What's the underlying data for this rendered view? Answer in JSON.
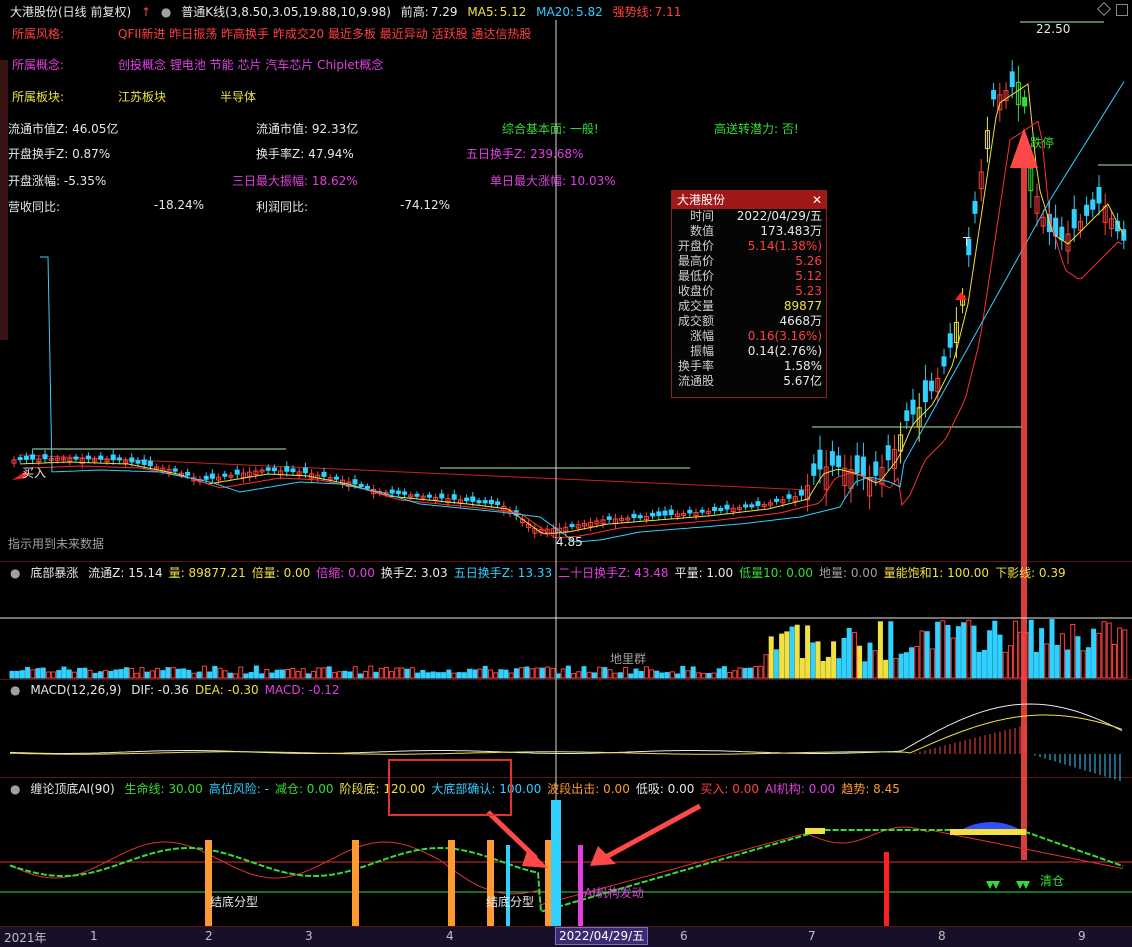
{
  "header": {
    "stock": "大港股份(日线 前复权)",
    "kline": "普通K线(3,8.50,3.05,19.88,10,9.98)",
    "prev_high_label": "前高:",
    "prev_high": "7.29",
    "ma5_label": "MA5:",
    "ma5": "5.12",
    "ma20_label": "MA20:",
    "ma20": "5.82",
    "strong_label": "强势线:",
    "strong": "7.11"
  },
  "info": {
    "style_label": "所属风格:",
    "style_value": "QFII新进 昨日振荡 昨高换手 昨成交20 最近多板 最近异动 活跃股 通达信热股",
    "concept_label": "所属概念:",
    "concept_value": "创投概念 锂电池 节能 芯片 汽车芯片 Chiplet概念",
    "sector_label": "所属板块:",
    "sector_a": "江苏板块",
    "sector_b": "半导体",
    "float_mv_z": "流通市值Z: 46.05亿",
    "float_mv": "流通市值: 92.33亿",
    "fundamental": "综合基本面: 一般!",
    "high_send": "高送转潜力: 否!",
    "open_turn_z": "开盘换手Z: 0.87%",
    "turn_z": "换手率Z: 47.94%",
    "five_turn_z": "五日换手Z: 239.68%",
    "open_rise": "开盘涨幅: -5.35%",
    "max3_amp": "三日最大振幅: 18.62%",
    "max_day_rise": "单日最大涨幅: 10.03%",
    "rev_yoy_label": "营收同比:",
    "rev_yoy": "-18.24%",
    "profit_yoy_label": "利润同比:",
    "profit_yoy": "-74.12%"
  },
  "price_panel": {
    "high_mark": "22.50",
    "low_mark": "4.85",
    "buy_label": "买入",
    "limit_label": "跌停",
    "t_label": "T",
    "future_note": "指示用到未来数据"
  },
  "tooltip": {
    "title": "大港股份",
    "rows": [
      {
        "k": "时间",
        "v": "2022/04/29/五",
        "color": "#e8e8e8"
      },
      {
        "k": "数值",
        "v": "173.483万",
        "color": "#e8e8e8"
      },
      {
        "k": "开盘价",
        "v": "5.14(1.38%)",
        "color": "#ff4040"
      },
      {
        "k": "最高价",
        "v": "5.26",
        "color": "#ff4040"
      },
      {
        "k": "最低价",
        "v": "5.12",
        "color": "#ff4040"
      },
      {
        "k": "收盘价",
        "v": "5.23",
        "color": "#ff4040"
      },
      {
        "k": "成交量",
        "v": "89877",
        "color": "#f0e040"
      },
      {
        "k": "成交额",
        "v": "4668万",
        "color": "#e8e8e8"
      },
      {
        "k": "涨幅",
        "v": "0.16(3.16%)",
        "color": "#ff4040"
      },
      {
        "k": "振幅",
        "v": "0.14(2.76%)",
        "color": "#e8e8e8"
      },
      {
        "k": "换手率",
        "v": "1.58%",
        "color": "#e8e8e8"
      },
      {
        "k": "流通股",
        "v": "5.67亿",
        "color": "#e8e8e8"
      }
    ]
  },
  "vol_panel": {
    "title": "底部暴涨",
    "items": [
      {
        "t": "流通Z: 15.14",
        "c": "#e8e8e8"
      },
      {
        "t": "量: 89877.21",
        "c": "#f0e040"
      },
      {
        "t": "倍量: 0.00",
        "c": "#f0e040"
      },
      {
        "t": "倍缩: 0.00",
        "c": "#e040e0"
      },
      {
        "t": "换手Z: 3.03",
        "c": "#e8e8e8"
      },
      {
        "t": "五日换手Z: 13.33",
        "c": "#30d0ff"
      },
      {
        "t": "二十日换手Z: 43.48",
        "c": "#e040e0"
      },
      {
        "t": "平量: 1.00",
        "c": "#e8e8e8"
      },
      {
        "t": "低量10: 0.00",
        "c": "#33dd33"
      },
      {
        "t": "地量: 0.00",
        "c": "#a0a0a0"
      },
      {
        "t": "量能饱和1: 100.00",
        "c": "#f0e040"
      },
      {
        "t": "下影线: 0.39",
        "c": "#f0e040"
      }
    ],
    "ground_label": "地里群"
  },
  "macd_panel": {
    "title": "MACD(12,26,9)",
    "items": [
      {
        "t": "DIF: -0.36",
        "c": "#e8e8e8"
      },
      {
        "t": "DEA: -0.30",
        "c": "#f0e040"
      },
      {
        "t": "MACD: -0.12",
        "c": "#e040e0"
      }
    ]
  },
  "ai_panel": {
    "title": "缠论顶底AI(90)",
    "items": [
      {
        "t": "生命线: 30.00",
        "c": "#33dd33"
      },
      {
        "t": "高位风险: -",
        "c": "#30d0ff"
      },
      {
        "t": "减仓: 0.00",
        "c": "#33dd33"
      },
      {
        "t": "阶段底: 120.00",
        "c": "#f0e040"
      },
      {
        "t": "大底部确认: 100.00",
        "c": "#30d0ff"
      },
      {
        "t": "波段出击: 0.00",
        "c": "#ff9a30"
      },
      {
        "t": "低吸: 0.00",
        "c": "#e8e8e8"
      },
      {
        "t": "买入: 0.00",
        "c": "#ff4040"
      },
      {
        "t": "AI机构: 0.00",
        "c": "#e040e0"
      },
      {
        "t": "趋势: 8.45",
        "c": "#ff9a30"
      }
    ],
    "bottom_pattern_a": "结底分型",
    "bottom_pattern_b": "结底分型",
    "inst_label": "AI机构发动",
    "clear_label": "清仓"
  },
  "axis": {
    "labels": [
      "2021年",
      "1",
      "2",
      "3",
      "4",
      "6",
      "7",
      "8",
      "9"
    ],
    "cursor_date": "2022/04/29/五"
  },
  "colors": {
    "up": "#ff4040",
    "down": "#30d0ff",
    "yellow": "#f0e040",
    "green": "#33dd33",
    "magenta": "#e040e0",
    "separator": "#5a1414"
  }
}
